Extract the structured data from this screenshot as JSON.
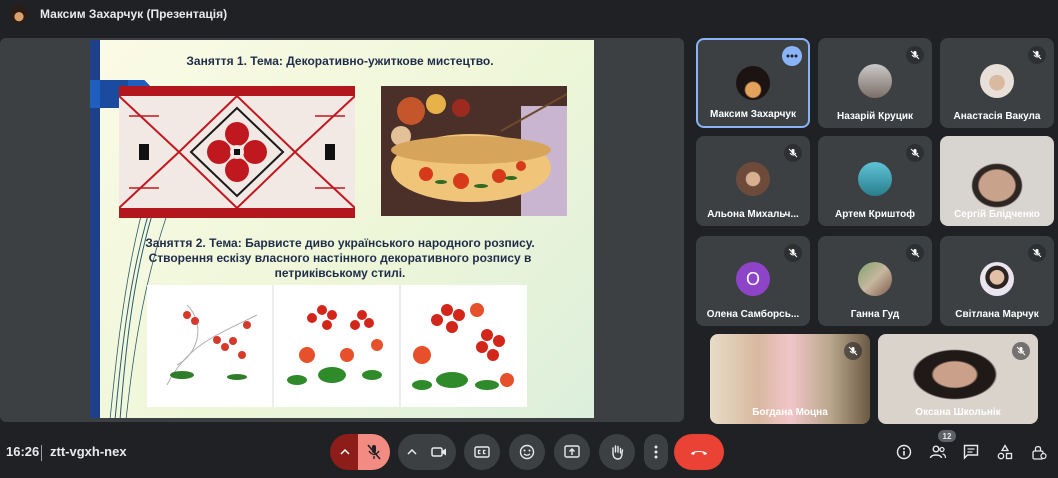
{
  "header": {
    "presenter_title": "Максим Захарчук (Презентація)"
  },
  "slide": {
    "lesson1_title": "Заняття 1. Тема: Декоративно-ужиткове мистецтво.",
    "lesson2_line1": "Заняття 2. Тема:  Барвисте диво українського народного розпису.",
    "lesson2_line2": "Створення ескізу власного настінного декоративного розпису в",
    "lesson2_line3": "петриківському стилі."
  },
  "participants": [
    {
      "name": "Максим Захарчук",
      "muted": false,
      "active": true
    },
    {
      "name": "Назарій Круцик",
      "muted": true
    },
    {
      "name": "Анастасія Вакула",
      "muted": true
    },
    {
      "name": "Альона Михальч...",
      "muted": true
    },
    {
      "name": "Артем Криштоф",
      "muted": true
    },
    {
      "name": "Сергій Блідченко",
      "muted": true
    },
    {
      "name": "Олена Самборсь...",
      "muted": true,
      "initial": "О"
    },
    {
      "name": "Ганна Гуд",
      "muted": true
    },
    {
      "name": "Світлана Марчук",
      "muted": true
    },
    {
      "name": "Богдана Моцна",
      "muted": true
    },
    {
      "name": "Оксана Школьнік",
      "muted": true
    }
  ],
  "footer": {
    "time": "16:26",
    "meeting_code": "ztt-vgxh-nex",
    "participants_count": "12"
  },
  "colors": {
    "accent": "#8ab4f8",
    "hangup": "#ea4335",
    "mic_off": "#f28b82",
    "background": "#202124"
  },
  "icons": [
    "mic-off-icon",
    "camera-icon",
    "captions-icon",
    "emoji-icon",
    "present-icon",
    "raise-hand-icon",
    "more-vert-icon",
    "hangup-icon",
    "info-icon",
    "people-icon",
    "chat-icon",
    "activities-icon",
    "host-controls-icon"
  ]
}
